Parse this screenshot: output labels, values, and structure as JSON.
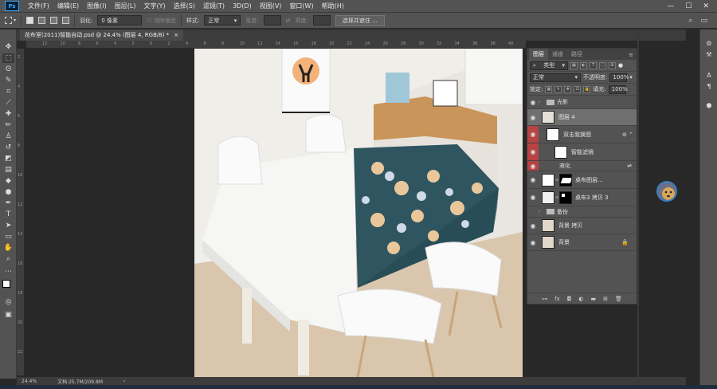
{
  "menu": [
    "文件(F)",
    "编辑(E)",
    "图像(I)",
    "图层(L)",
    "文字(Y)",
    "选择(S)",
    "滤镜(T)",
    "3D(D)",
    "视图(V)",
    "窗口(W)",
    "帮助(H)"
  ],
  "options": {
    "feather_label": "羽化:",
    "feather_value": "0 像素",
    "antialias_label": "消除锯齿",
    "style_label": "样式:",
    "style_value": "正常",
    "width_label": "宽度:",
    "height_label": "高度:",
    "select_mask_button": "选择并遮住 ..."
  },
  "document": {
    "tab_title": "花布室(2011)智能自动.psd @ 24.4% (图层 4, RGB/8) *",
    "close": "×"
  },
  "ruler": {
    "h": [
      "12",
      "10",
      "8",
      "6",
      "4",
      "2",
      "0",
      "2",
      "4",
      "6",
      "8",
      "10",
      "12",
      "14",
      "16",
      "18",
      "20",
      "22",
      "24",
      "26",
      "28",
      "30",
      "32",
      "34",
      "36",
      "38",
      "40"
    ],
    "v": [
      "2",
      "4",
      "6",
      "8",
      "10",
      "12",
      "14",
      "16",
      "18",
      "20",
      "22"
    ]
  },
  "status": {
    "zoom": "24.4%",
    "doc_size": "文档:25.7M/209.8M"
  },
  "layers_panel": {
    "tabs": [
      "图层",
      "通道",
      "路径"
    ],
    "kind_filter": "类型",
    "blend_mode": "正常",
    "opacity_label": "不透明度:",
    "opacity_value": "100%",
    "lock_label": "锁定:",
    "fill_label": "填充:",
    "fill_value": "100%",
    "layers": [
      {
        "name": "光影",
        "type": "group"
      },
      {
        "name": "图层 4",
        "type": "layer",
        "selected": true
      },
      {
        "name": "双击我换图",
        "type": "smart"
      },
      {
        "name": "智能滤镜",
        "type": "filter-header"
      },
      {
        "name": "液化",
        "type": "filter"
      },
      {
        "name": "桌布图层...",
        "type": "layer-mask"
      },
      {
        "name": "桌布3 拷贝 3",
        "type": "layer-mask"
      },
      {
        "name": "备份",
        "type": "group"
      },
      {
        "name": "背景 拷贝",
        "type": "layer"
      },
      {
        "name": "背景",
        "type": "locked"
      }
    ],
    "footer_icons": [
      "link-icon",
      "fx-icon",
      "mask-icon",
      "adjustment-icon",
      "folder-icon",
      "new-layer-icon",
      "trash-icon"
    ]
  },
  "colors": {
    "ui_dark": "#535353",
    "canvas_bg": "#282828",
    "tablecloth": "#2f5560",
    "highlight": "#6f6f6f",
    "warning": "#b84343"
  }
}
